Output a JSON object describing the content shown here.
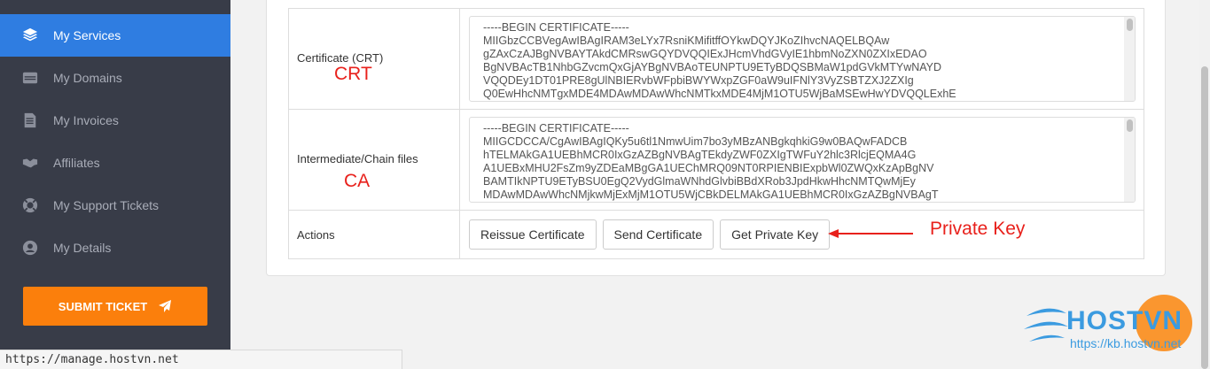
{
  "sidebar": {
    "items": [
      {
        "label": "My Services",
        "icon": "layers-icon"
      },
      {
        "label": "My Domains",
        "icon": "server-icon"
      },
      {
        "label": "My Invoices",
        "icon": "invoice-icon"
      },
      {
        "label": "Affiliates",
        "icon": "handshake-icon"
      },
      {
        "label": "My Support Tickets",
        "icon": "lifebuoy-icon"
      },
      {
        "label": "My Details",
        "icon": "user-circle-icon"
      }
    ],
    "submit_ticket": "SUBMIT TICKET"
  },
  "status_bar": {
    "url": "https://manage.hostvn.net"
  },
  "table": {
    "crt_label": "Certificate (CRT)",
    "crt_annotation": "CRT",
    "crt_text": "-----BEGIN CERTIFICATE-----\nMIIGbzCCBVegAwIBAgIRAM3eLYx7RsniKMifitffOYkwDQYJKoZIhvcNAQELBQAw\ngZAxCzAJBgNVBAYTAkdCMRswGQYDVQQIExJHcmVhdGVyIE1hbmNoZXN0ZXIxEDAO\nBgNVBAcTB1NhbGZvcmQxGjAYBgNVBAoTEUNPTU9ETyBDQSBMaW1pdGVkMTYwNAYD\nVQQDEy1DT01PRE8gUlNBIERvbWFpbiBWYWxpZGF0aW9uIFNlY3VyZSBTZXJ2ZXIg\nQ0EwHhcNMTgxMDE4MDAwMDAwWhcNMTkxMDE4MjM1OTU5WjBaMSEwHwYDVQQLExhE",
    "ca_label": "Intermediate/Chain files",
    "ca_annotation": "CA",
    "ca_text": "-----BEGIN CERTIFICATE-----\nMIIGCDCCA/CgAwIBAgIQKy5u6tl1NmwUim7bo3yMBzANBgkqhkiG9w0BAQwFADCB\nhTELMAkGA1UEBhMCR0IxGzAZBgNVBAgTEkdyZWF0ZXIgTWFuY2hlc3RlcjEQMA4G\nA1UEBxMHU2FsZm9yZDEaMBgGA1UEChMRQ09NT0RPIENBIExpbWl0ZWQxKzApBgNV\nBAMTIkNPTU9ETyBSU0EgQ2VydGlmaWNhdGlvbiBBdXRob3JpdHkwHhcNMTQwMjEy\nMDAwMDAwWhcNMjkwMjExMjM1OTU5WjCBkDELMAkGA1UEBhMCR0IxGzAZBgNVBAgT",
    "actions_label": "Actions",
    "buttons": {
      "reissue": "Reissue Certificate",
      "send": "Send Certificate",
      "private_key": "Get Private Key"
    },
    "private_key_annotation": "Private Key"
  },
  "watermark": {
    "brand": "HOSTVN",
    "url": "https://kb.hostvn.net"
  },
  "colors": {
    "sidebar_bg": "#383c48",
    "active": "#2f7de1",
    "accent_orange": "#fb7f0c",
    "annotation_red": "#e8211c",
    "logo_blue": "#3b9be0"
  }
}
